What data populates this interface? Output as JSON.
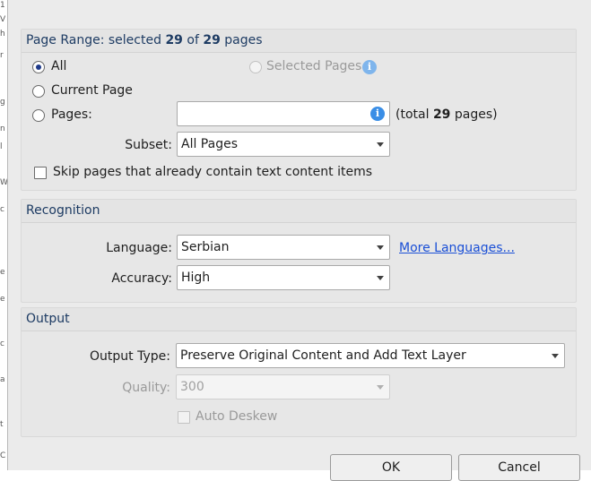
{
  "page_range": {
    "header_prefix": "Page Range: selected ",
    "selected_count": "29",
    "header_of": " of ",
    "total_count": "29",
    "header_suffix": " pages",
    "all_label": "All",
    "selected_pages_label": "Selected Pages",
    "current_page_label": "Current Page",
    "pages_label": "Pages:",
    "pages_input_value": "",
    "total_prefix": "(total ",
    "total_value": "29",
    "total_suffix": " pages)",
    "subset_label": "Subset:",
    "subset_value": "All Pages",
    "skip_label": "Skip pages that already contain text content items"
  },
  "recognition": {
    "header": "Recognition",
    "language_label": "Language:",
    "language_value": "Serbian",
    "more_languages_link": "More Languages...",
    "accuracy_label": "Accuracy:",
    "accuracy_value": "High"
  },
  "output": {
    "header": "Output",
    "output_type_label": "Output Type:",
    "output_type_value": "Preserve Original Content and Add Text Layer",
    "quality_label": "Quality:",
    "quality_value": "300",
    "auto_deskew_label": "Auto Deskew"
  },
  "buttons": {
    "ok": "OK",
    "cancel": "Cancel"
  },
  "icons": {
    "info": "i"
  }
}
